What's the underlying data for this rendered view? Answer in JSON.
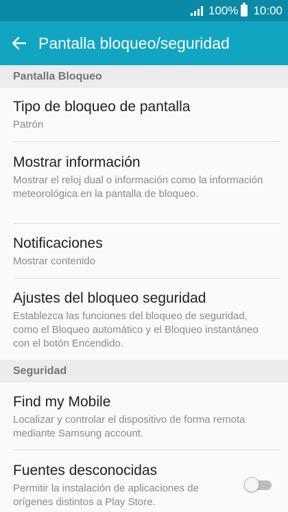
{
  "status_bar": {
    "battery_percent": "100%",
    "time": "10:00",
    "icons": [
      "signal-icon",
      "battery-icon"
    ]
  },
  "app_bar": {
    "back_icon": "arrow-back-icon",
    "title": "Pantalla bloqueo/seguridad"
  },
  "sections": {
    "lock": "Pantalla Bloqueo",
    "security": "Seguridad"
  },
  "items": {
    "screen_lock_type": {
      "title": "Tipo de bloqueo de pantalla",
      "subtitle": "Patrón"
    },
    "show_info": {
      "title": "Mostrar información",
      "subtitle": "Mostrar el reloj dual o información como la información meteorológica en la pantalla de bloqueo."
    },
    "notifications": {
      "title": "Notificaciones",
      "subtitle": "Mostrar contenido"
    },
    "security_lock_settings": {
      "title": "Ajustes del bloqueo seguridad",
      "subtitle": "Establezca las funciones del bloqueo de seguridad, como el Bloqueo automático y el Bloqueo instantáneo con el botón Encendido."
    },
    "find_my_mobile": {
      "title": "Find my Mobile",
      "subtitle": "Localizar y controlar el dispositivo de forma remota mediante Samsung account."
    },
    "unknown_sources": {
      "title": "Fuentes desconocidas",
      "subtitle": "Permitir la instalación de aplicaciones de orígenes distintos a Play Store.",
      "toggle_on": false
    }
  },
  "colors": {
    "status_bar": "#0a8aa6",
    "app_bar": "#12a5c2",
    "section_header": "#ececec"
  }
}
